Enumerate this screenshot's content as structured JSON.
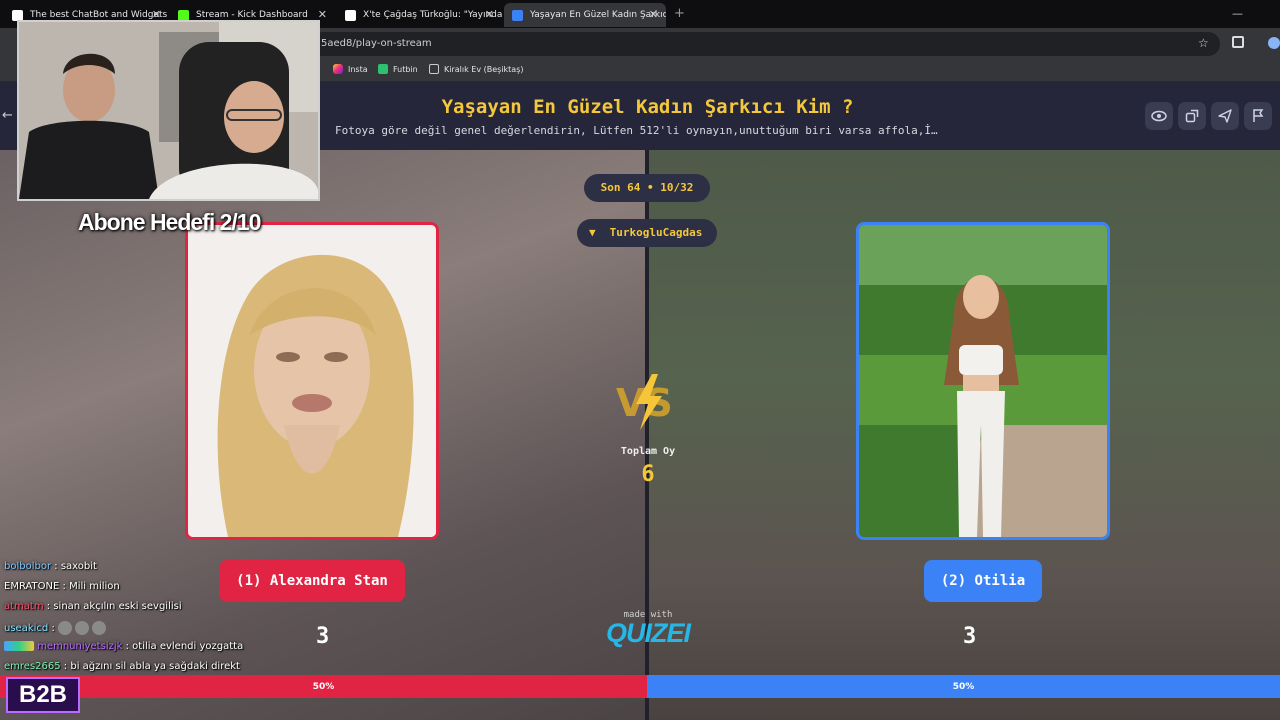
{
  "browser": {
    "tabs": [
      {
        "title": "The best ChatBot and Widgets",
        "icon": "kick-bot-icon",
        "color": "#ffffff"
      },
      {
        "title": "Stream - Kick Dashboard",
        "icon": "kick-icon",
        "color": "#53fc18"
      },
      {
        "title": "X'te Çağdaş Türkoğlu: \"Yayında",
        "icon": "x-icon",
        "color": "#ffffff"
      },
      {
        "title": "Yaşayan En Güzel Kadın Şarkıcı",
        "icon": "quizei-icon",
        "color": "#3b82f6"
      }
    ],
    "url": "5aed8/play-on-stream",
    "bookmarks": [
      {
        "label": "Insta",
        "icon": "instagram-icon"
      },
      {
        "label": "Futbin",
        "icon": "futbin-icon"
      },
      {
        "label": "Kiralık Ev (Beşiktaş)",
        "icon": "folder-icon"
      }
    ]
  },
  "quiz": {
    "title": "Yaşayan En Güzel Kadın Şarkıcı Kim ?",
    "subtitle": "Fotoya göre değil genel değerlendirin, Lütfen 512'li oynayın,unuttuğum biri varsa affola,İ…",
    "round": "Son 64 • 10/32",
    "host": "TurkogluCagdas",
    "vs": "VS",
    "total_votes_label": "Toplam Oy",
    "total_votes": "6",
    "made_with": "made with",
    "brand": "QUIZEI",
    "left": {
      "name": "(1) Alexandra Stan",
      "votes": "3",
      "percent": "50%",
      "share": 0.5
    },
    "right": {
      "name": "(2) Otilia",
      "votes": "3",
      "percent": "50%",
      "share": 0.5
    },
    "colors": {
      "left": "#e22444",
      "right": "#3b82f6",
      "accent": "#f4c83a"
    }
  },
  "overlay": {
    "goal": "Abone Hedefi 2/10",
    "chat": [
      {
        "user": "bolbolbor",
        "text": ": saxobit",
        "color": "#7ec8ff"
      },
      {
        "user": "EMRATONE",
        "text": ": Mili milion",
        "color": "#ffffff"
      },
      {
        "user": "atmatm",
        "text": ": sinan akçılın eski sevgilisi",
        "color": "#ff4d6d"
      },
      {
        "user": "useakicd",
        "text": ":",
        "color": "#7ee0ff"
      },
      {
        "user": "memnuniyetsizjk",
        "text": ": otilia evlendi yozgatta",
        "color": "#b66cff"
      },
      {
        "user": "emres2665",
        "text": ": bi ağzını sil abla ya sağdaki direkt",
        "color": "#7ef0b0"
      }
    ],
    "logo": "B2B"
  }
}
